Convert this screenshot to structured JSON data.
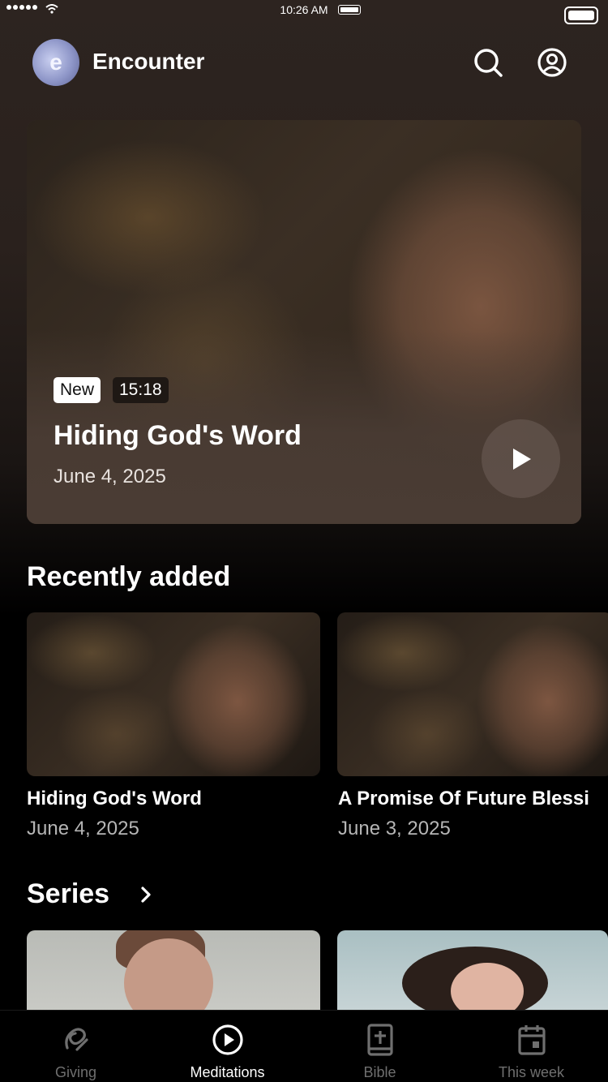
{
  "status_bar": {
    "time": "10:26 AM"
  },
  "header": {
    "logo_letter": "e",
    "app_title": "Encounter",
    "icons": [
      "search-icon",
      "profile-icon"
    ]
  },
  "hero": {
    "badge_new": "New",
    "duration": "15:18",
    "title": "Hiding God's Word",
    "date": "June 4, 2025",
    "play_icon": "play-icon"
  },
  "recently_added": {
    "heading": "Recently added",
    "items": [
      {
        "title": "Hiding God's Word",
        "date": "June 4, 2025"
      },
      {
        "title": "A Promise Of Future Blessi",
        "date": "June 3, 2025"
      }
    ]
  },
  "series": {
    "heading": "Series",
    "chevron_icon": "chevron-right-icon"
  },
  "tabbar": {
    "active": "Meditations",
    "tabs": [
      {
        "label": "Giving",
        "icon": "giving-icon"
      },
      {
        "label": "Meditations",
        "icon": "play-circle-icon"
      },
      {
        "label": "Bible",
        "icon": "bible-icon"
      },
      {
        "label": "This week",
        "icon": "calendar-icon"
      }
    ]
  },
  "colors": {
    "background": "#000000",
    "hero_panel": "#4a3c34",
    "inactive_tab": "#6f6f6f",
    "active_tab": "#ffffff"
  }
}
